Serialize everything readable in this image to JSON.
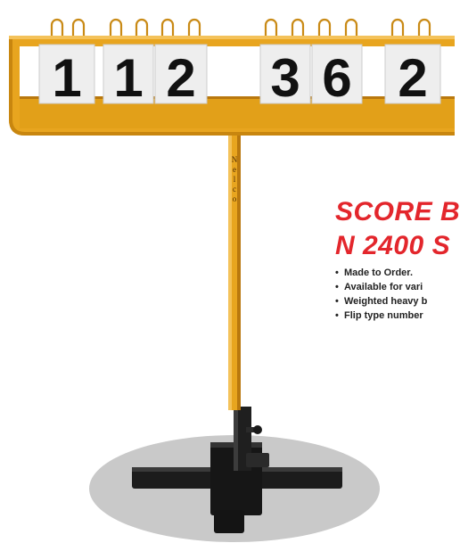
{
  "product": {
    "brand": "Nelco",
    "score_cards": [
      "1",
      "1",
      "2",
      "3",
      "6",
      "2"
    ]
  },
  "title": {
    "line1": "SCORE B",
    "line2": "N 2400 S"
  },
  "features": [
    "Made to Order.",
    "Available for vari",
    "Weighted heavy b",
    "Flip type number"
  ],
  "colors": {
    "frame": "#e8a51f",
    "frame_dark": "#b9780e",
    "title_red": "#e3262c",
    "base_black": "#1c1c1c",
    "floor_shadow": "#c9c9c9"
  }
}
